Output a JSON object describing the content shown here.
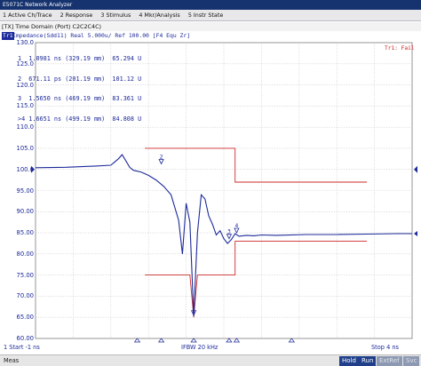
{
  "window": {
    "title": "E5071C Network Analyzer"
  },
  "menu": [
    {
      "label": "1 Active Ch/Trace"
    },
    {
      "label": "2 Response"
    },
    {
      "label": "3 Stimulus"
    },
    {
      "label": "4 Mkr/Analysis"
    },
    {
      "label": "5 Instr State"
    }
  ],
  "time_domain_header": "[TX] Time Domain (Port) C2C2C4C)",
  "trace": {
    "id": "Tr1",
    "description": "Impedance(Sdd11) Real 5.000u/ Ref 100.00 [F4 Equ Zr]"
  },
  "markers": [
    {
      "num": "1",
      "time": "1.0981 ns",
      "length": "(329.19 mm)",
      "value": "65.294 U"
    },
    {
      "num": "2",
      "time": "671.11 ps",
      "length": "(201.19 mm)",
      "value": "101.12 U"
    },
    {
      "num": "3",
      "time": "1.5650 ns",
      "length": "(469.19 mm)",
      "value": "83.361 U"
    },
    {
      "num": ">4",
      "time": "1.6651 ns",
      "length": "(499.19 mm)",
      "value": "84.808 U"
    }
  ],
  "limit_status": "Tr1: Fail",
  "chart_data": {
    "type": "line",
    "title": "",
    "xlabel": "",
    "ylabel": "",
    "xlim": [
      -1,
      4
    ],
    "x_unit": "ns",
    "ylim": [
      60,
      130
    ],
    "yticks": [
      "130.0",
      "125.0",
      "120.0",
      "115.0",
      "110.0",
      "105.0",
      "100.0",
      "95.00",
      "90.00",
      "85.00",
      "80.00",
      "75.00",
      "70.00",
      "65.00",
      "60.00"
    ],
    "reference_level": 100,
    "series": [
      {
        "color": "#1c2a9a",
        "x": [
          -1.0,
          -0.6,
          -0.2,
          0.0,
          0.1,
          0.15,
          0.2,
          0.25,
          0.3,
          0.4,
          0.5,
          0.6,
          0.7,
          0.8,
          0.9,
          0.95,
          1.0,
          1.05,
          1.1,
          1.15,
          1.2,
          1.25,
          1.3,
          1.35,
          1.4,
          1.45,
          1.5,
          1.55,
          1.6,
          1.65,
          1.7,
          1.8,
          1.9,
          2.0,
          2.2,
          2.6,
          3.0,
          3.4,
          3.8,
          4.0
        ],
        "y": [
          100.4,
          100.5,
          100.8,
          101.0,
          102.5,
          103.5,
          102.0,
          100.5,
          99.8,
          99.4,
          98.6,
          97.5,
          96.0,
          94.0,
          88.0,
          80.0,
          92.0,
          87.5,
          65.3,
          85.0,
          94.0,
          93.0,
          89.0,
          87.0,
          84.5,
          85.5,
          83.6,
          82.5,
          83.4,
          84.8,
          84.2,
          84.4,
          84.3,
          84.5,
          84.4,
          84.6,
          84.6,
          84.7,
          84.8,
          84.8
        ]
      }
    ],
    "limit_lines": [
      {
        "color": "#cc2a2a",
        "points": [
          [
            0.45,
            105
          ],
          [
            1.65,
            105
          ],
          [
            1.65,
            97
          ],
          [
            3.4,
            97
          ]
        ]
      },
      {
        "color": "#cc2a2a",
        "points": [
          [
            0.45,
            75
          ],
          [
            1.05,
            75
          ],
          [
            1.1,
            65
          ],
          [
            1.15,
            75
          ],
          [
            1.65,
            75
          ],
          [
            1.65,
            83
          ],
          [
            3.4,
            83
          ]
        ]
      }
    ],
    "marker_points": [
      {
        "label": "1",
        "x": 1.1,
        "y": 65.3
      },
      {
        "label": "2",
        "x": 0.67,
        "y": 101.1
      },
      {
        "label": "3",
        "x": 1.57,
        "y": 83.4
      },
      {
        "label": "4",
        "x": 1.67,
        "y": 84.8
      }
    ]
  },
  "footer": {
    "start": "1 Start -1 ns",
    "ifbw": "IFBW 20 kHz",
    "stop": "Stop 4 ns"
  },
  "statusbar": {
    "meas": "Meas",
    "hold": "Hold",
    "run": "Run",
    "extref": "ExtRef",
    "svc": "Svc"
  }
}
